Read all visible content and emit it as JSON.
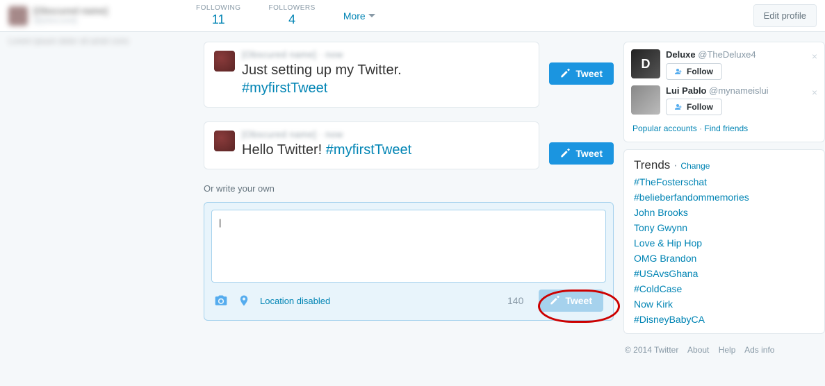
{
  "header": {
    "profile_name": "[Obscured name]",
    "profile_handle": "@[obscured]",
    "stats": [
      {
        "label": "FOLLOWING",
        "value": "11"
      },
      {
        "label": "FOLLOWERS",
        "value": "4"
      }
    ],
    "more": "More",
    "edit_profile": "Edit profile"
  },
  "tweets": [
    {
      "header": "[Obscured name] · now",
      "text": "Just setting up my Twitter.",
      "hashtag": "#myfirstTweet",
      "button": "Tweet"
    },
    {
      "header": "[Obscured name] · now",
      "text": "Hello Twitter! ",
      "hashtag": "#myfirstTweet",
      "button": "Tweet"
    }
  ],
  "compose": {
    "prompt": "Or write your own",
    "value": "",
    "location": "Location disabled",
    "char_count": "140",
    "submit": "Tweet"
  },
  "suggestions": {
    "items": [
      {
        "name": "Deluxe",
        "handle": "@TheDeluxe4",
        "follow": "Follow"
      },
      {
        "name": "Lui Pablo",
        "handle": "@mynameislui",
        "follow": "Follow"
      }
    ],
    "links": {
      "popular": "Popular accounts",
      "find": "Find friends"
    }
  },
  "trends": {
    "title": "Trends",
    "change": "Change",
    "items": [
      "#TheFosterschat",
      "#belieberfandommemories",
      "John Brooks",
      "Tony Gwynn",
      "Love & Hip Hop",
      "OMG Brandon",
      "#USAvsGhana",
      "#ColdCase",
      "Now Kirk",
      "#DisneyBabyCA"
    ]
  },
  "footer": {
    "copyright": "© 2014 Twitter",
    "about": "About",
    "help": "Help",
    "ads": "Ads info"
  }
}
